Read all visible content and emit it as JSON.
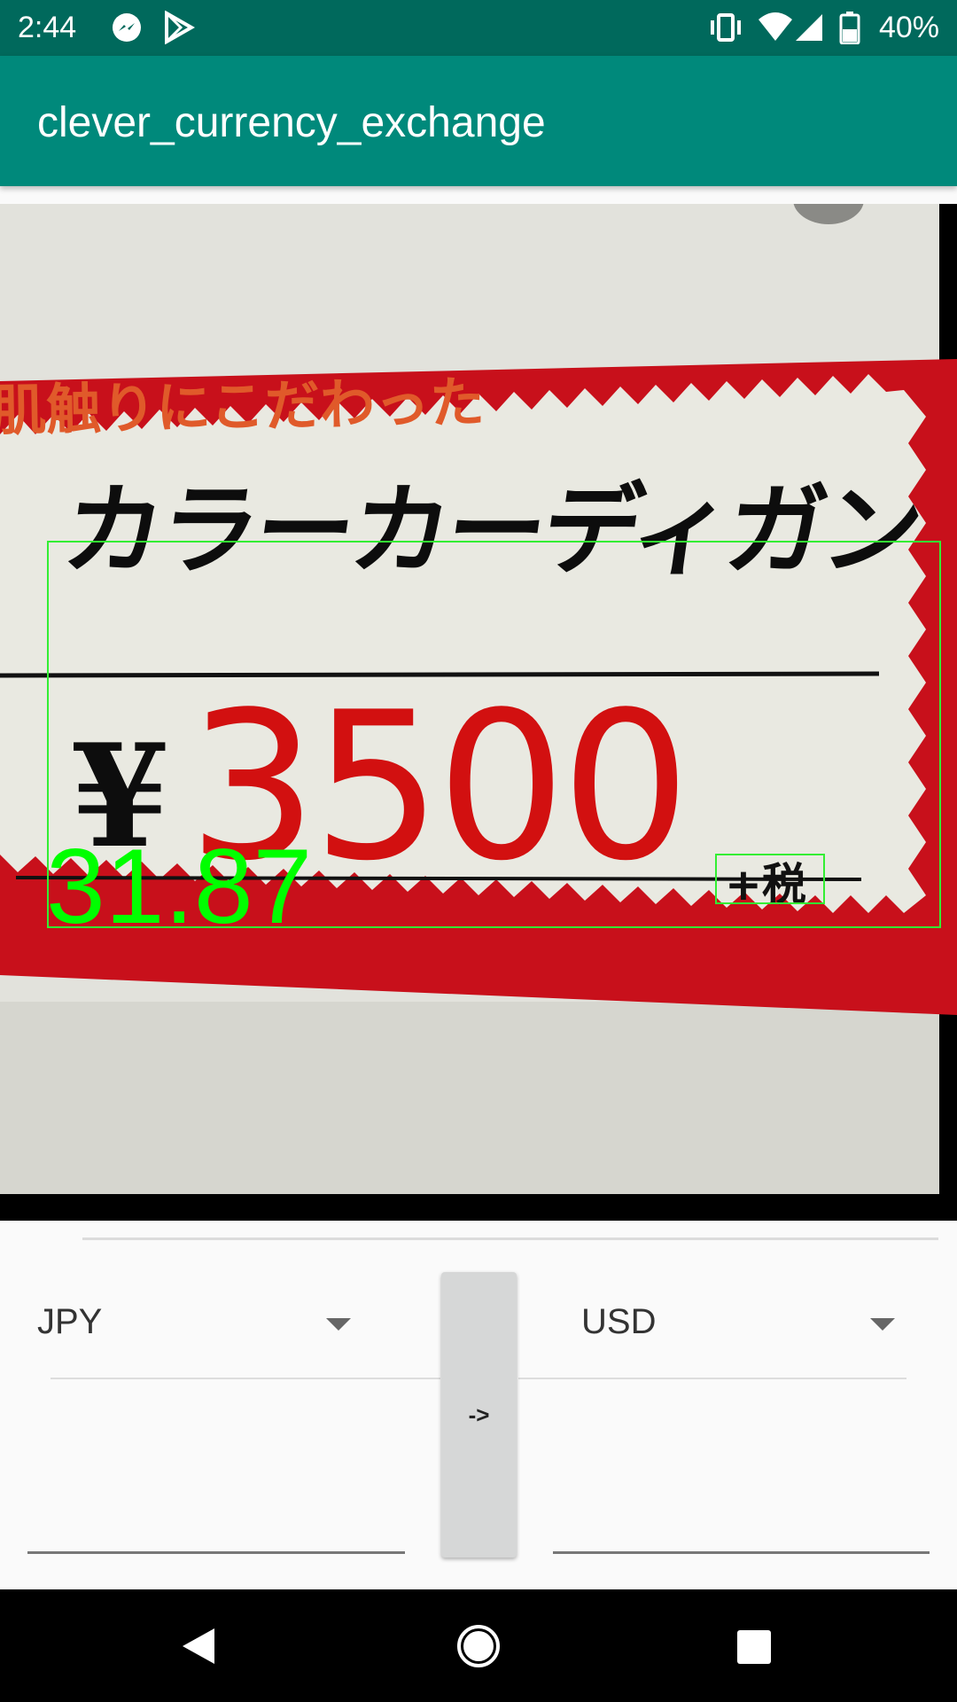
{
  "status": {
    "time": "2:44",
    "battery": "40%",
    "icons": [
      "messenger-icon",
      "play-store-icon",
      "vibrate-icon",
      "wifi-icon",
      "signal-icon",
      "battery-icon"
    ]
  },
  "app": {
    "title": "clever_currency_exchange",
    "toolbar_color": "#00897b",
    "status_color": "#00695c"
  },
  "camera": {
    "sign_line1": "肌触りにこだわった",
    "sign_line2": "カラーカーディガン",
    "yen_symbol": "¥",
    "price": "3500",
    "tax_label": "+税",
    "converted_overlay": "31.87",
    "overlay_color": "#00ff00"
  },
  "converter": {
    "from_currency": "JPY",
    "to_currency": "USD",
    "convert_label": "->",
    "from_value": "",
    "to_value": ""
  },
  "nav": {
    "icons": [
      "back-icon",
      "home-icon",
      "recents-icon"
    ]
  }
}
